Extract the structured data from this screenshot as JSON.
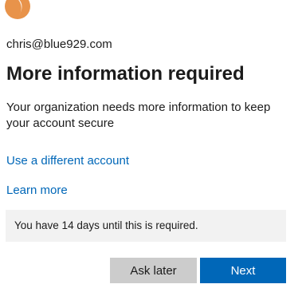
{
  "account": {
    "email": "chris@blue929.com",
    "logo_icon": "org-logo-icon"
  },
  "page": {
    "title": "More information required",
    "description": "Your organization needs more information to keep your account secure"
  },
  "links": {
    "different_account": "Use a different account",
    "learn_more": "Learn more"
  },
  "notice": {
    "text": "You have 14 days until this is required."
  },
  "buttons": {
    "ask_later": "Ask later",
    "next": "Next"
  },
  "colors": {
    "accent": "#0067b8",
    "logo": "#e8934a",
    "secondary_button": "#cccccc",
    "notice_background": "#f2f2f2"
  }
}
